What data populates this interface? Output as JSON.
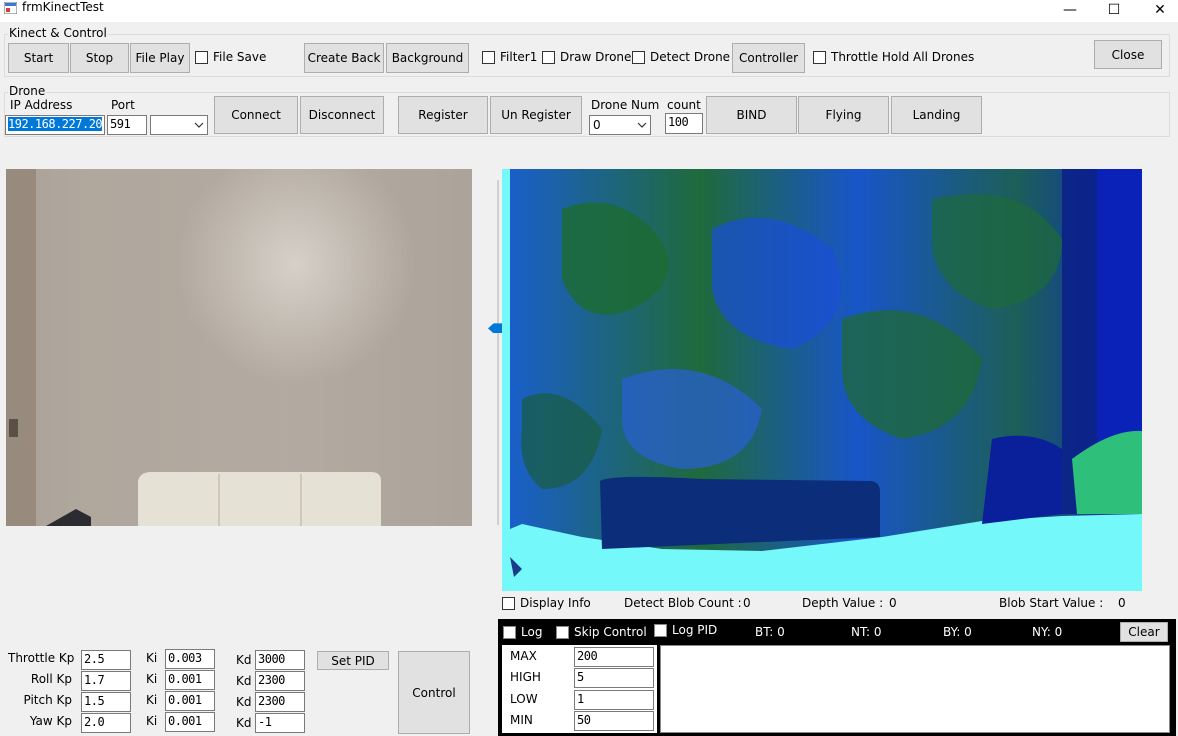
{
  "window": {
    "title": "frmKinectTest",
    "minimize_glyph": "—",
    "maximize_glyph": "☐",
    "close_glyph": "✕",
    "icon": "app-icon"
  },
  "kinect": {
    "group_label": "Kinect & Control",
    "start": "Start",
    "stop": "Stop",
    "file_play": "File Play",
    "file_save": "File Save",
    "create_back": "Create Back",
    "background": "Background",
    "filter1": "Filter1",
    "draw_drone": "Draw Drone",
    "detect_drone": "Detect Drone",
    "controller": "Controller",
    "throttle_hold": "Throttle Hold All Drones",
    "close": "Close"
  },
  "drone": {
    "group_label": "Drone",
    "ip_label": "IP Address",
    "ip_value": "192.168.227.20",
    "port_label": "Port",
    "port_value": "591",
    "port_combo_value": "",
    "connect": "Connect",
    "disconnect": "Disconnect",
    "register": "Register",
    "unregister": "Un Register",
    "drone_num_label": "Drone Num",
    "drone_num_value": "0",
    "count_label": "count",
    "count_value": "100",
    "bind": "BIND",
    "flying": "Flying",
    "landing": "Landing"
  },
  "depth_info": {
    "display_info": "Display Info",
    "detect_blob_label": "Detect Blob Count :",
    "detect_blob_value": "0",
    "depth_value_label": "Depth Value :",
    "depth_value": "0",
    "blob_start_label": "Blob Start Value :",
    "blob_start_value": "0"
  },
  "slider": {
    "level": 0.43
  },
  "pid": {
    "rows": [
      {
        "label": "Throttle Kp",
        "kp": "2.5",
        "ki_label": "Ki",
        "ki": "0.003",
        "kd_label": "Kd",
        "kd": "3000"
      },
      {
        "label": "Roll Kp",
        "kp": "1.7",
        "ki_label": "Ki",
        "ki": "0.001",
        "kd_label": "Kd",
        "kd": "2300"
      },
      {
        "label": "Pitch Kp",
        "kp": "1.5",
        "ki_label": "Ki",
        "ki": "0.001",
        "kd_label": "Kd",
        "kd": "2300"
      },
      {
        "label": "Yaw Kp",
        "kp": "2.0",
        "ki_label": "Ki",
        "ki": "0.001",
        "kd_label": "Kd",
        "kd": "-1"
      }
    ],
    "set_pid": "Set PID",
    "control": "Control"
  },
  "log": {
    "log": "Log",
    "skip_control": "Skip Control",
    "log_pid": "Log PID",
    "bt": "BT: 0",
    "nt": "NT: 0",
    "by": "BY: 0",
    "ny": "NY: 0",
    "clear": "Clear",
    "thresholds": [
      {
        "label": "MAX",
        "value": "200"
      },
      {
        "label": "HIGH",
        "value": "5"
      },
      {
        "label": "LOW",
        "value": "1"
      },
      {
        "label": "MIN",
        "value": "50"
      }
    ]
  },
  "colors": {
    "depth_floor": "#74f8fa",
    "depth_blue": "#1a4fd0",
    "depth_green": "#1e6a35",
    "selection": "#0078d7"
  }
}
